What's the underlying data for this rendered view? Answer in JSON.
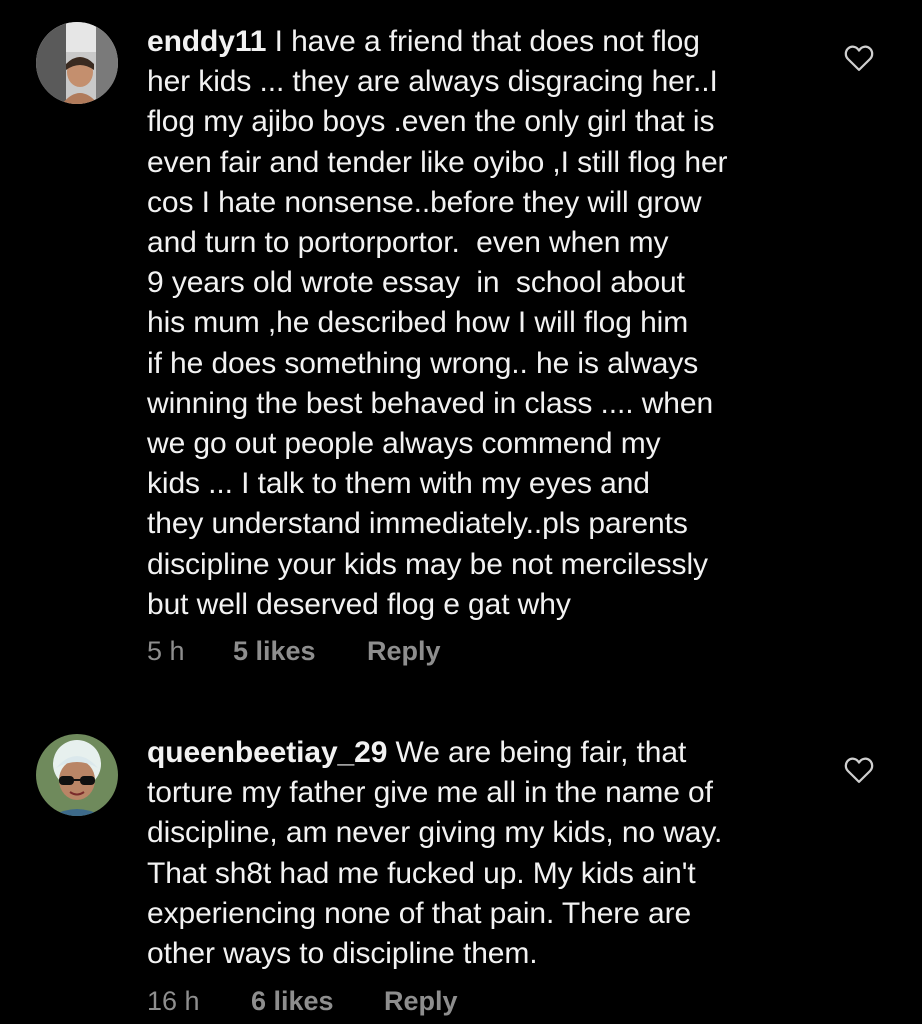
{
  "comments": [
    {
      "avatar_icon": "user-avatar-photo",
      "username": "enddy11",
      "lines": [
        " I have a friend that does not flog",
        "her kids ... they are always disgracing her..I",
        "flog my ajibo boys .even the only girl that is",
        "even fair and tender like oyibo ,I still flog her",
        "cos I hate nonsense..before they will grow",
        "and turn to portorportor.  even when my",
        "9 years old wrote essay  in  school about",
        "his mum ,he described how I will flog him",
        "if he does something wrong.. he is always",
        "winning the best behaved in class .... when",
        "we go out people always commend my",
        "kids ... I talk to them with my eyes and",
        "they understand immediately..pls parents",
        "discipline your kids may be not mercilessly",
        "but well deserved flog e gat why"
      ],
      "time": "5 h",
      "likes": "5 likes",
      "reply": "Reply",
      "like_icon": "heart-outline-icon"
    },
    {
      "avatar_icon": "user-avatar-photo",
      "username": "queenbeetiay_29",
      "lines": [
        " We are being fair, that",
        "torture my father give me all in the name of",
        "discipline, am never giving my kids, no way.",
        "That sh8t had me fucked up. My kids ain't",
        "experiencing none of that pain. There are",
        "other ways to discipline them."
      ],
      "time": "16 h",
      "likes": "6 likes",
      "reply": "Reply",
      "like_icon": "heart-outline-icon"
    }
  ],
  "colors": {
    "background": "#000000",
    "text": "#f2f2f2",
    "meta": "#8e8e8e"
  }
}
